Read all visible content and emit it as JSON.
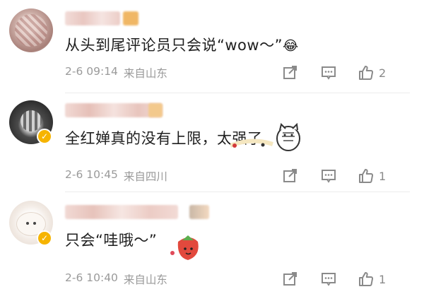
{
  "comments": [
    {
      "text": "从头到尾评论员只会说“wow～”",
      "emoji": "😂",
      "date": "2-6 09:14",
      "location": "来自山东",
      "like_count": "2"
    },
    {
      "text": "全红婵真的没有上限，太强了",
      "date": "2-6 10:45",
      "location": "来自四川",
      "like_count": "1"
    },
    {
      "text": "只会“哇哦～”",
      "date": "2-6 10:40",
      "location": "来自山东",
      "like_count": "1"
    }
  ],
  "icons": {
    "share": "share-icon",
    "comment": "comment-icon",
    "like": "thumbs-up-icon",
    "verified": "verified-badge-icon"
  },
  "colors": {
    "meta_text": "#9a9a9a",
    "verified_badge": "#f6b400",
    "icon_gray": "#888888"
  }
}
